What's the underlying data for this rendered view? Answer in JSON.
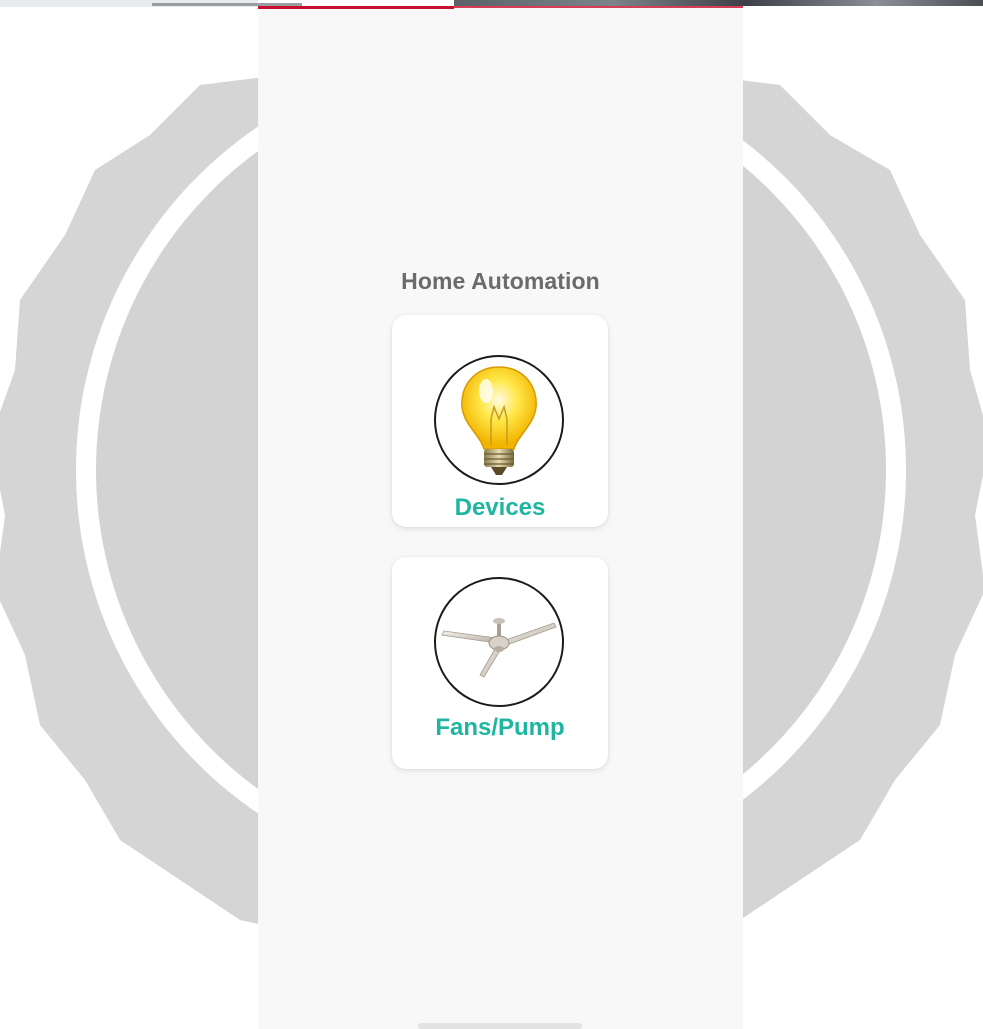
{
  "app": {
    "title": "Home Automation"
  },
  "cards": [
    {
      "label": "Devices",
      "icon": "light-bulb-icon"
    },
    {
      "label": "Fans/Pump",
      "icon": "ceiling-fan-icon"
    }
  ],
  "colors": {
    "accent": "#1eb6a0",
    "title": "#6b6b6b",
    "screen_background": "#f8f8f8",
    "card_background": "#ffffff",
    "status_accent": "#c8102e",
    "backdrop_badge": "#d5d5d5"
  }
}
